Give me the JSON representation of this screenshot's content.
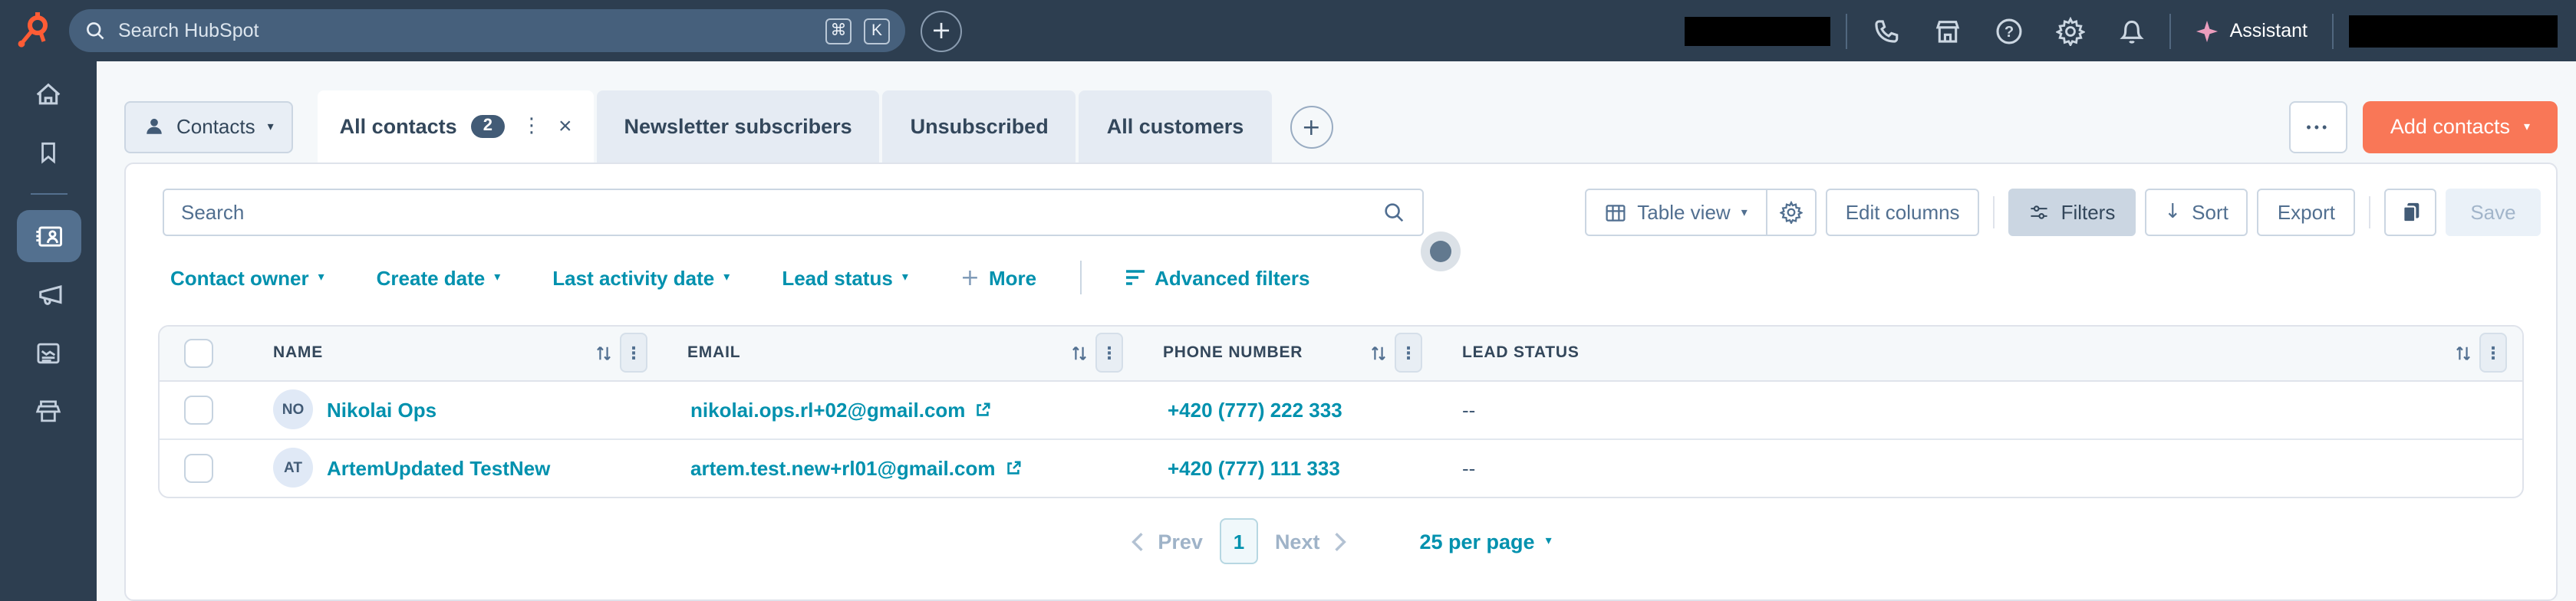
{
  "topnav": {
    "search_placeholder": "Search HubSpot",
    "shortcut": [
      "⌘",
      "K"
    ],
    "assistant": "Assistant"
  },
  "header": {
    "object_switcher": "Contacts",
    "tabs": {
      "active_label": "All contacts",
      "active_count": "2",
      "others": [
        "Newsletter subscribers",
        "Unsubscribed",
        "All customers"
      ]
    },
    "add_contacts": "Add contacts"
  },
  "toolbar": {
    "search_placeholder": "Search",
    "table_view": "Table view",
    "edit_columns": "Edit columns",
    "filters": "Filters",
    "sort": "Sort",
    "export": "Export",
    "save": "Save"
  },
  "quick_filters": {
    "contact_owner": "Contact owner",
    "create_date": "Create date",
    "last_activity_date": "Last activity date",
    "lead_status": "Lead status",
    "more": "More",
    "advanced": "Advanced filters"
  },
  "table": {
    "columns": [
      "NAME",
      "EMAIL",
      "PHONE NUMBER",
      "LEAD STATUS"
    ],
    "rows": [
      {
        "initials": "NO",
        "name": "Nikolai Ops",
        "email": "nikolai.ops.rl+02@gmail.com",
        "phone": "+420 (777) 222 333",
        "lead_status": "--"
      },
      {
        "initials": "AT",
        "name": "ArtemUpdated TestNew",
        "email": "artem.test.new+rl01@gmail.com",
        "phone": "+420 (777) 111 333",
        "lead_status": "--"
      }
    ]
  },
  "pagination": {
    "prev": "Prev",
    "current_page": "1",
    "next": "Next",
    "per_page": "25 per page"
  },
  "icons": {
    "plus": "+",
    "kebab": "⋮",
    "close": "×",
    "caret": "▾",
    "sort_arrow": "↓",
    "ellipsis": "•••"
  },
  "colors": {
    "nav_bg": "#2d3e50",
    "accent_orange": "#f97757",
    "link_teal": "#0091ae",
    "text_dark": "#33475b"
  }
}
